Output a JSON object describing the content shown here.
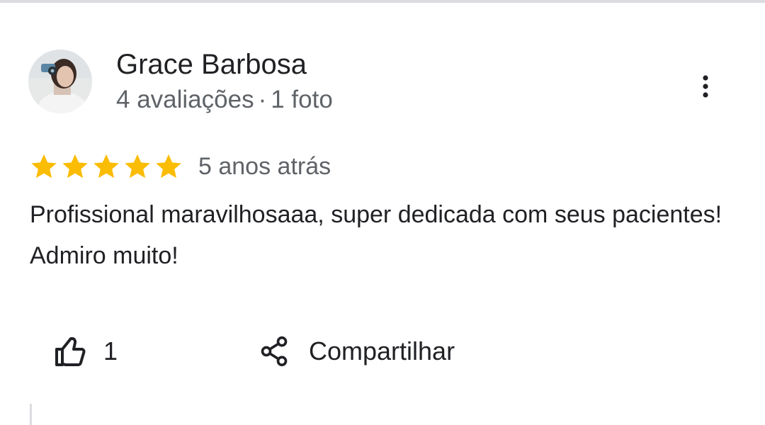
{
  "review": {
    "author": {
      "name": "Grace Barbosa",
      "reviews_count": "4 avaliações",
      "separator": "·",
      "photos_count": "1 foto",
      "avatar_icon": "profile-photo"
    },
    "rating": {
      "stars": 5,
      "max_stars": 5,
      "color": "#fbbc04"
    },
    "time_ago": "5 anos atrás",
    "text": "Profissional maravilhosaaa, super dedicada com seus pacientes! Admiro muito!",
    "actions": {
      "like_icon": "thumbs-up-icon",
      "like_count": "1",
      "share_icon": "share-icon",
      "share_label": "Compartilhar",
      "more_icon": "more-vert-icon"
    }
  }
}
